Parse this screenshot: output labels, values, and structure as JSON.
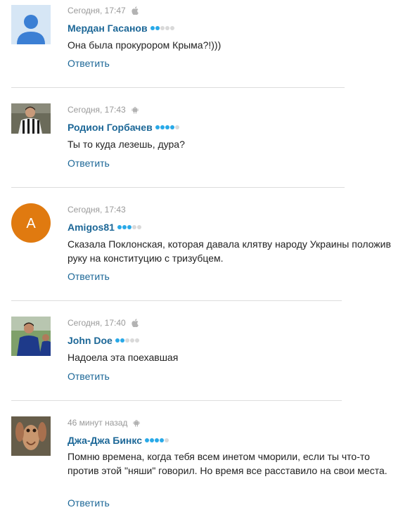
{
  "colors": {
    "author": "#1c6797",
    "reply": "#1c6797",
    "dot_on": "#29a9e8",
    "dot_off": "#d9d9d9",
    "meta": "#999999"
  },
  "reply_label": "Ответить",
  "comments": [
    {
      "time": "Сегодня, 17:47",
      "platform": "apple-icon",
      "author": "Мердан Гасанов",
      "rating": 2,
      "text": "Она была прокурором Крыма?!)))",
      "avatar": "default-user-avatar"
    },
    {
      "time": "Сегодня, 17:43",
      "platform": "android-icon",
      "author": "Родион Горбачев",
      "rating": 4,
      "text": "Ты то куда лезешь, дура?",
      "avatar": "photo-avatar"
    },
    {
      "time": "Сегодня, 17:43",
      "platform": "",
      "author": "Amigos81",
      "rating": 3,
      "text": "Сказала Поклонская, которая давала клятву народу Украины положив руку на конституцию с тризубцем.",
      "avatar_letter": "A",
      "avatar": "letter-avatar"
    },
    {
      "time": "Сегодня, 17:40",
      "platform": "apple-icon",
      "author": "John Doe",
      "rating": 2,
      "text": "Надоела эта поехавшая",
      "avatar": "photo-avatar"
    },
    {
      "time": "46 минут назад",
      "platform": "android-icon",
      "author": "Джа-Джа Бинкс",
      "rating": 4,
      "text": "Помню времена, когда тебя всем инетом чморили, если ты что-то против этой \"няши\" говорил. Но время все расставило на свои места.",
      "avatar": "photo-avatar"
    }
  ]
}
